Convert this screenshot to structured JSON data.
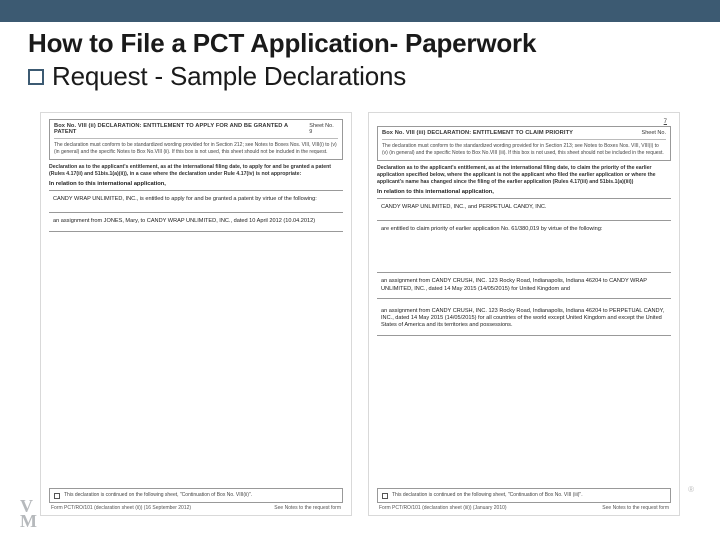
{
  "title": {
    "line1": "How to File a PCT Application- Paperwork",
    "line2": "Request - Sample Declarations"
  },
  "docLeft": {
    "headerLeft": "Box No. VIII (ii)   DECLARATION: ENTITLEMENT TO APPLY FOR AND BE GRANTED A PATENT",
    "headerRight": "Sheet No.    9",
    "instruction1": "The declaration must conform to be standardized wording provided for in Section 212; see Notes to Boxes Nos. VIII, VIII(i) to (v) (in general) and the specific Notes to Box No.VIII (ii). If this box is not used, this sheet should not be included in the request.",
    "instruction2": "Declaration as to the applicant's entitlement, as at the international filing date, to apply for and be granted a patent (Rules 4.17(ii) and 51bis.1(a)(ii)), in a case where the declaration under Rule 4.17(iv) is not appropriate:",
    "relationLine": "In relation to this international application,",
    "entityLine": "CANDY WRAP UNLIMITED, INC., is entitled to apply for and be granted a patent by virtue of the following:",
    "assignment": "an assignment from JONES, Mary, to CANDY WRAP UNLIMITED, INC., dated 10 April 2012 (10.04.2012)",
    "footerText": "This declaration is continued on the following sheet, \"Continuation of Box No. VIII(ii)\".",
    "formId": "Form PCT/RO/101 (declaration sheet (ii)) (16 September 2012)",
    "formRight": "See Notes to the request form"
  },
  "docRight": {
    "pageInd": "7",
    "headerLeft": "Box No. VIII (iii)   DECLARATION: ENTITLEMENT TO CLAIM PRIORITY",
    "headerRight": "Sheet No.",
    "instruction1": "The declaration must conform to the standardized wording provided for in Section 213; see Notes to Boxes Nos. VIII, VIII(i) to (v) (in general) and the specific Notes to Box No.VIII (iii). If this box is not used, this sheet should not be included in the request.",
    "instruction2": "Declaration as to the applicant's entitlement, as at the international filing date, to claim the priority of the earlier application specified below, where the applicant is not the applicant who filed the earlier application or where the applicant's name has changed since the filing of the earlier application (Rules 4.17(iii) and 51bis.1(a)(iii))",
    "relationLine": "In relation to this international application,",
    "entityLine": "CANDY WRAP UNLIMITED, INC., and PERPETUAL CANDY, INC.",
    "claimLine": "are entitled to claim priority of earlier application No. 61/380,019  by virtue of the following:",
    "assignment1": "an assignment from CANDY CRUSH, INC. 123 Rocky Road, Indianapolis, Indiana 46204 to CANDY WRAP UNLIMITED, INC., dated 14 May 2015 (14/05/2015) for United Kingdom and",
    "assignment2": "an assignment from CANDY CRUSH, INC. 123 Rocky Road, Indianapolis, Indiana 46204 to PERPETUAL CANDY, INC., dated  14 May 2015 (14/05/2015) for all countries of the world except United Kingdom and except the United States of America and its territories and possessions.",
    "footerText": "This declaration is continued on the following sheet, \"Continuation of Box No. VIII (iii)\".",
    "formId": "Form PCT/RO/101 (declaration sheet (iii)) (January 2010)",
    "formRight": "See Notes to the request form"
  },
  "watermark": {
    "line1": "V",
    "line2": "M"
  },
  "regmark": "®"
}
